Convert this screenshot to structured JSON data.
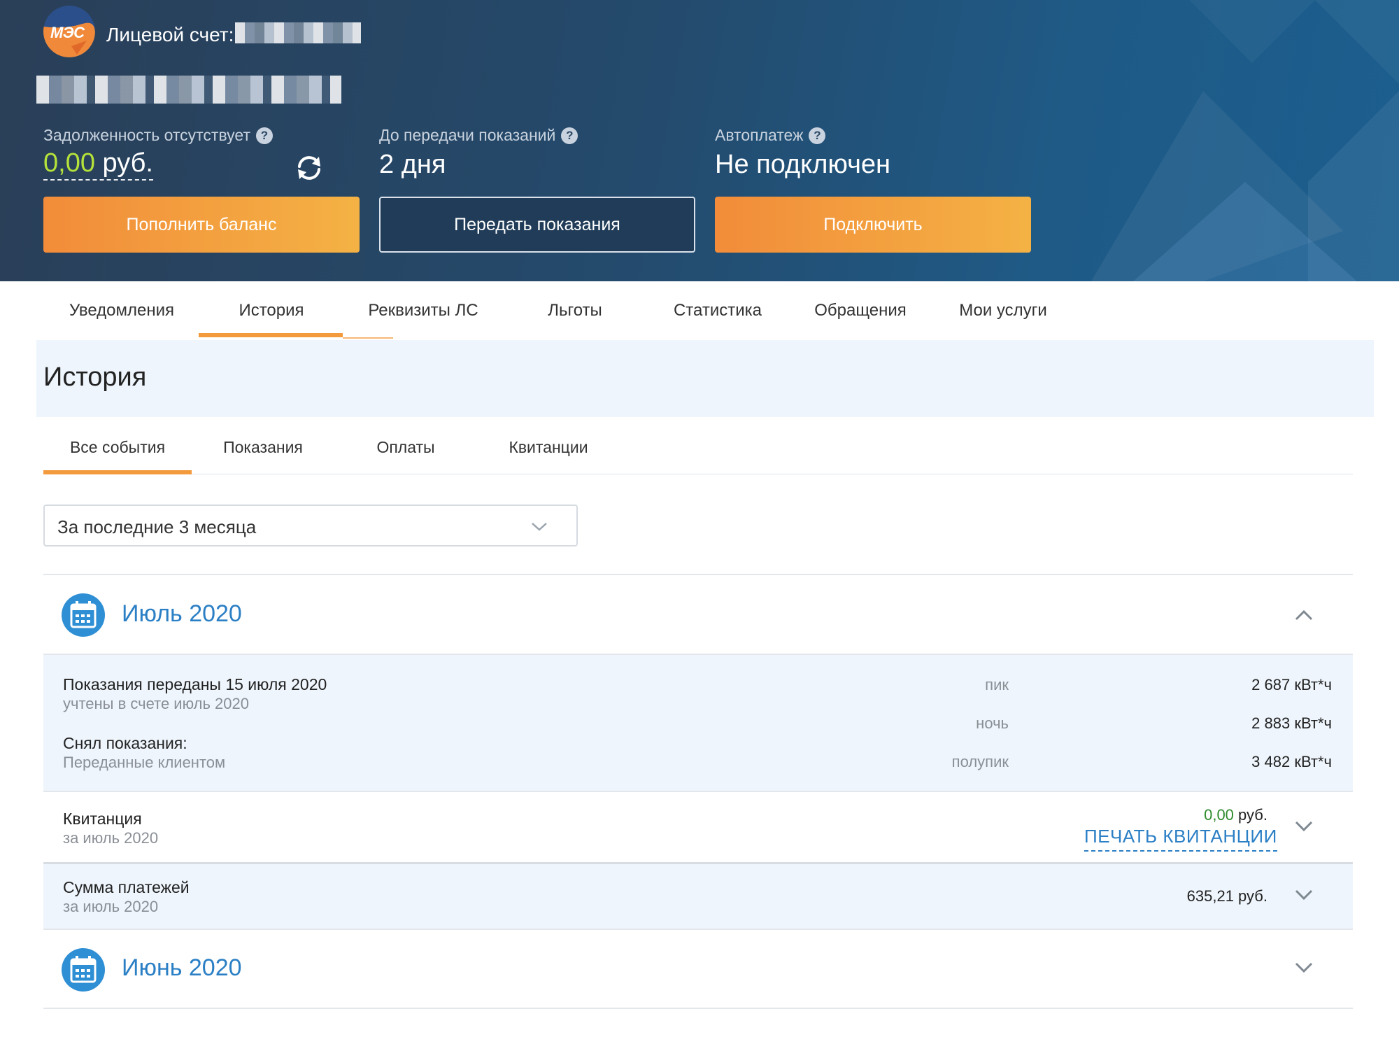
{
  "header": {
    "logo_text": "МЭС",
    "account_label": "Лицевой счет:",
    "debt": {
      "label": "Задолженность отсутствует",
      "amount": "0,00",
      "currency": "руб."
    },
    "readings": {
      "label": "До передачи показаний",
      "value": "2 дня"
    },
    "autopay": {
      "label": "Автоплатеж",
      "value": "Не подключен"
    },
    "buttons": {
      "topup": "Пополнить баланс",
      "submit_readings": "Передать показания",
      "connect": "Подключить"
    },
    "help_glyph": "?"
  },
  "tabs": [
    "Уведомления",
    "История",
    "Реквизиты ЛС",
    "Льготы",
    "Статистика",
    "Обращения",
    "Мои услуги"
  ],
  "active_tab": "История",
  "section_title": "История",
  "subtabs": [
    "Все события",
    "Показания",
    "Оплаты",
    "Квитанции"
  ],
  "filter": {
    "selected": "За последние 3 месяца"
  },
  "months": [
    {
      "title": "Июль 2020",
      "expanded": true,
      "readings": {
        "title": "Показания переданы 15 июля 2020",
        "subtitle": "учтены в счете июль 2020",
        "taker_label": "Снял показания:",
        "taker_value": "Переданные клиентом",
        "rows": [
          {
            "label": "пик",
            "value": "2 687 кВт*ч"
          },
          {
            "label": "ночь",
            "value": "2 883 кВт*ч"
          },
          {
            "label": "полупик",
            "value": "3 482 кВт*ч"
          }
        ]
      },
      "receipt": {
        "title": "Квитанция",
        "subtitle": "за июль 2020",
        "amount": "0,00",
        "currency": "руб.",
        "print_link": "ПЕЧАТЬ КВИТАНЦИИ"
      },
      "payments": {
        "title": "Сумма платежей",
        "subtitle": "за июль 2020",
        "amount": "635,21 руб."
      }
    },
    {
      "title": "Июнь 2020",
      "expanded": false
    }
  ],
  "colors": {
    "accent_orange": "#f39a3c",
    "link_blue": "#2b7fc5",
    "header_dark": "#2a3f58",
    "panel_blue": "#eef5fc",
    "debt_green": "#b5e23a"
  }
}
